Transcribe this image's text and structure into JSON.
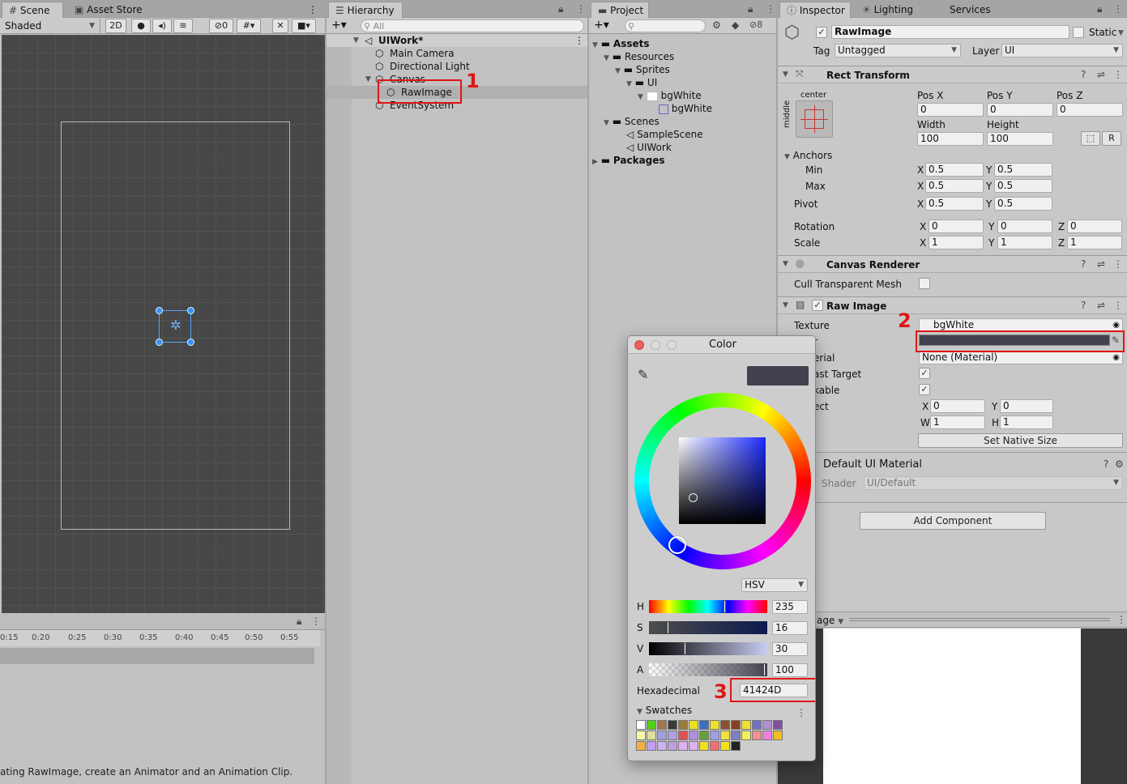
{
  "scene": {
    "tabs": [
      "Scene",
      "Asset Store"
    ],
    "shading": "Shaded",
    "mode_2d": "2D",
    "gizmo_count": "0",
    "timeline_ticks": [
      "0:15",
      "0:20",
      "0:25",
      "0:30",
      "0:35",
      "0:40",
      "0:45",
      "0:50",
      "0:55"
    ],
    "status_text": "ating RawImage, create an Animator and an Animation Clip."
  },
  "hierarchy": {
    "tab": "Hierarchy",
    "search_placeholder": "All",
    "scene_name": "UIWork*",
    "items": [
      "Main Camera",
      "Directional Light",
      "Canvas",
      "RawImage",
      "EventSystem"
    ]
  },
  "project": {
    "tab": "Project",
    "hidden_count": "8",
    "items": [
      "Assets",
      "Resources",
      "Sprites",
      "UI",
      "bgWhite",
      "bgWhite",
      "Scenes",
      "SampleScene",
      "UIWork",
      "Packages"
    ]
  },
  "inspector": {
    "tabs": [
      "Inspector",
      "Lighting",
      "Services"
    ],
    "object_name": "RawImage",
    "static_label": "Static",
    "tag_label": "Tag",
    "tag_value": "Untagged",
    "layer_label": "Layer",
    "layer_value": "UI",
    "rect_transform": {
      "title": "Rect Transform",
      "anchor_h": "center",
      "anchor_v": "middle",
      "pos_x_label": "Pos X",
      "pos_y_label": "Pos Y",
      "pos_z_label": "Pos Z",
      "pos_x": "0",
      "pos_y": "0",
      "pos_z": "0",
      "width_label": "Width",
      "height_label": "Height",
      "width": "100",
      "height": "100",
      "r_button": "R",
      "anchors_label": "Anchors",
      "min_label": "Min",
      "max_label": "Max",
      "min_x": "0.5",
      "min_y": "0.5",
      "max_x": "0.5",
      "max_y": "0.5",
      "pivot_label": "Pivot",
      "pivot_x": "0.5",
      "pivot_y": "0.5",
      "rotation_label": "Rotation",
      "rot_x": "0",
      "rot_y": "0",
      "rot_z": "0",
      "scale_label": "Scale",
      "scale_x": "1",
      "scale_y": "1",
      "scale_z": "1",
      "x": "X",
      "y": "Y",
      "z": "Z"
    },
    "canvas_renderer": {
      "title": "Canvas Renderer",
      "cull_label": "Cull Transparent Mesh"
    },
    "raw_image": {
      "title": "Raw Image",
      "texture_label": "Texture",
      "texture_value": "bgWhite",
      "color_label": "r",
      "material_label": "erial",
      "material_value": "None (Material)",
      "raycast_label": "ast Target",
      "maskable_label": "kable",
      "uvrect_label": "ect",
      "uv_x": "0",
      "uv_y": "0",
      "uv_w": "1",
      "uv_h": "1",
      "w_label": "W",
      "h_label": "H",
      "native_size_button": "Set Native Size",
      "color_hex": "#41424D"
    },
    "material": {
      "title": "Default UI Material",
      "shader_label": "Shader",
      "shader_value": "UI/Default"
    },
    "add_component": "Add Component",
    "preview_label": "age"
  },
  "color_picker": {
    "title": "Color",
    "mode": "HSV",
    "h_label": "H",
    "h_value": "235",
    "s_label": "S",
    "s_value": "16",
    "v_label": "V",
    "v_value": "30",
    "a_label": "A",
    "a_value": "100",
    "hex_label": "Hexadecimal",
    "hex_value": "41424D",
    "swatches_label": "Swatches",
    "current_color": "#41424D",
    "swatch_colors": [
      "#ffffff",
      "#52d017",
      "#a07850",
      "#3a3a3a",
      "#9a7a3a",
      "#e8e020",
      "#3a70c0",
      "#f0e030",
      "#8a5030",
      "#8a4020",
      "#f0e030",
      "#7070c0",
      "#b090d0",
      "#8050a0",
      "#f8f8a8",
      "#e0e0a0",
      "#a0a0e0",
      "#b0a0e0",
      "#e05050",
      "#b090e0",
      "#60a040",
      "#a0a0e0",
      "#f0e040",
      "#8080c0",
      "#f0f060",
      "#f09090",
      "#f080e0",
      "#f0c020",
      "#f0b040",
      "#c0a0f0",
      "#d0b0f0",
      "#c0a0e0",
      "#e0b0f0",
      "#e0b0f0",
      "#f0e020",
      "#f07070",
      "#f0e020",
      "#222222"
    ],
    "hue_position": 0.65,
    "sat_position": 0.16,
    "val_position": 0.3
  },
  "annotations": {
    "n1": "1",
    "n2": "2",
    "n3": "3"
  }
}
